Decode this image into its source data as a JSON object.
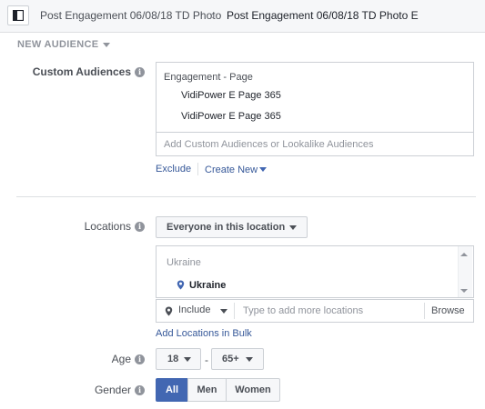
{
  "breadcrumb": {
    "parent": "Post Engagement 06/08/18 TD Photo",
    "current": "Post Engagement 06/08/18 TD Photo E"
  },
  "section": {
    "title": "NEW AUDIENCE"
  },
  "custom_audiences": {
    "label": "Custom Audiences",
    "group_header": "Engagement - Page",
    "items": [
      "VidiPower E Page 365",
      "VidiPower E Page 365"
    ],
    "input_placeholder": "Add Custom Audiences or Lookalike Audiences",
    "exclude_label": "Exclude",
    "create_new_label": "Create New"
  },
  "locations": {
    "label": "Locations",
    "scope_dropdown": "Everyone in this location",
    "group_header": "Ukraine",
    "items": [
      "Ukraine"
    ],
    "include_dropdown": "Include",
    "input_placeholder": "Type to add more locations",
    "browse_label": "Browse",
    "bulk_link": "Add Locations in Bulk"
  },
  "age": {
    "label": "Age",
    "min": "18",
    "separator": "-",
    "max": "65+"
  },
  "gender": {
    "label": "Gender",
    "options": [
      "All",
      "Men",
      "Women"
    ],
    "selected": "All"
  },
  "colors": {
    "accent": "#4267b2",
    "link": "#365899",
    "border": "#ccd0d5",
    "muted_text": "#90949c"
  }
}
